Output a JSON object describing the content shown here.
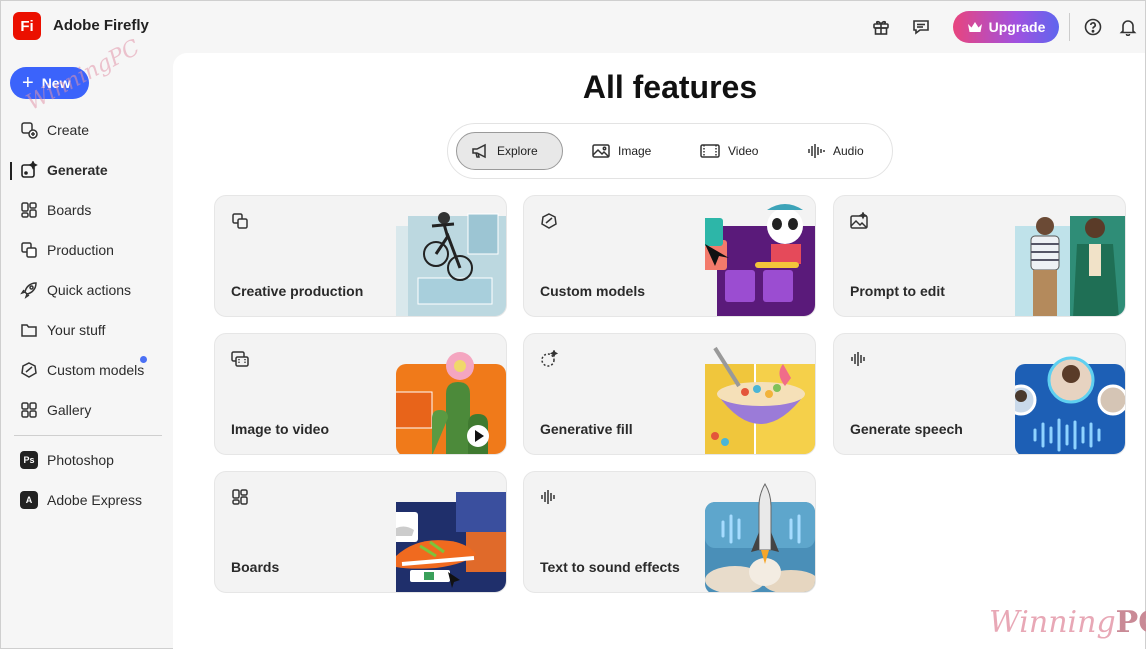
{
  "app": {
    "logo_text": "Fi",
    "title": "Adobe Firefly",
    "brand_color": "#eb1000"
  },
  "topbar": {
    "upgrade_label": "Upgrade"
  },
  "sidebar": {
    "new_label": "New",
    "items": [
      {
        "label": "Create",
        "icon": "create-icon"
      },
      {
        "label": "Generate",
        "icon": "generate-icon",
        "active": true
      },
      {
        "label": "Boards",
        "icon": "boards-icon"
      },
      {
        "label": "Production",
        "icon": "production-icon"
      },
      {
        "label": "Quick actions",
        "icon": "rocket-icon"
      },
      {
        "label": "Your stuff",
        "icon": "folder-icon"
      },
      {
        "label": "Custom models",
        "icon": "custom-models-icon",
        "badge_dot": true
      },
      {
        "label": "Gallery",
        "icon": "gallery-icon"
      }
    ],
    "apps": [
      {
        "label": "Photoshop",
        "badge": "Ps"
      },
      {
        "label": "Adobe Express",
        "badge": "A"
      }
    ]
  },
  "main": {
    "title": "All features",
    "tabs": [
      {
        "label": "Explore",
        "selected": true
      },
      {
        "label": "Image"
      },
      {
        "label": "Video"
      },
      {
        "label": "Audio"
      }
    ],
    "cards": [
      {
        "label": "Creative production"
      },
      {
        "label": "Custom models"
      },
      {
        "label": "Prompt to edit"
      },
      {
        "label": "Image to video"
      },
      {
        "label": "Generative fill"
      },
      {
        "label": "Generate speech"
      },
      {
        "label": "Boards"
      },
      {
        "label": "Text to sound effects"
      }
    ]
  },
  "watermark": {
    "prefix": "Winning",
    "suffix": "PC"
  },
  "colors": {
    "accent": "#3b63fb",
    "upgrade_gradient_start": "#e8457e",
    "upgrade_gradient_end": "#5f66ee"
  }
}
